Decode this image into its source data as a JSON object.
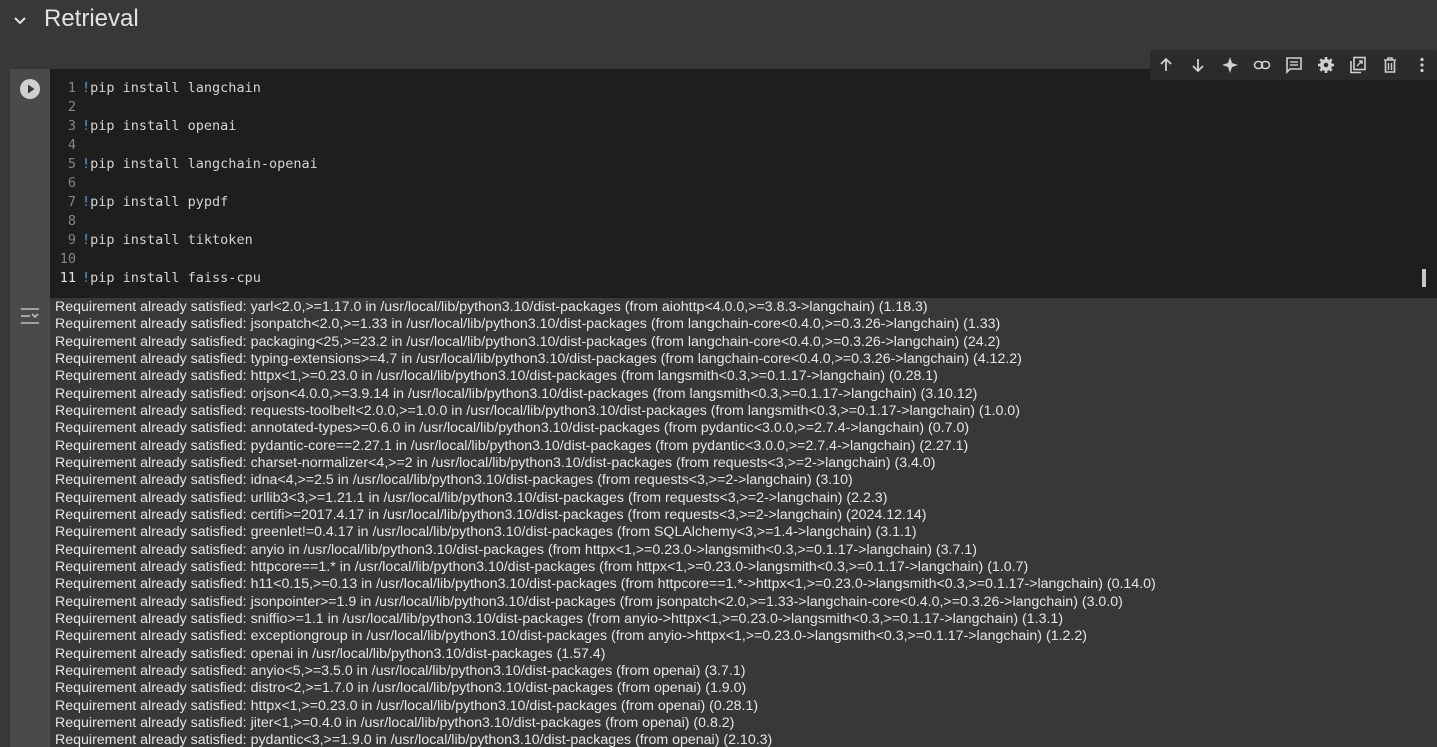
{
  "section": {
    "title": "Retrieval"
  },
  "code_lines": [
    {
      "num": "1",
      "bang": "!",
      "text": "pip install langchain"
    },
    {
      "num": "2",
      "bang": "",
      "text": ""
    },
    {
      "num": "3",
      "bang": "!",
      "text": "pip install openai"
    },
    {
      "num": "4",
      "bang": "",
      "text": ""
    },
    {
      "num": "5",
      "bang": "!",
      "text": "pip install langchain-openai"
    },
    {
      "num": "6",
      "bang": "",
      "text": ""
    },
    {
      "num": "7",
      "bang": "!",
      "text": "pip install pypdf"
    },
    {
      "num": "8",
      "bang": "",
      "text": ""
    },
    {
      "num": "9",
      "bang": "!",
      "text": "pip install tiktoken"
    },
    {
      "num": "10",
      "bang": "",
      "text": ""
    },
    {
      "num": "11",
      "bang": "!",
      "text": "pip install faiss-cpu"
    }
  ],
  "toolbar_icons": [
    "move-up-icon",
    "move-down-icon",
    "sparkle-icon",
    "link-icon",
    "comment-icon",
    "settings-icon",
    "mirror-cell-icon",
    "delete-icon",
    "more-options-icon"
  ],
  "output_lines": [
    "Requirement already satisfied: yarl<2.0,>=1.17.0 in /usr/local/lib/python3.10/dist-packages (from aiohttp<4.0.0,>=3.8.3->langchain) (1.18.3)",
    "Requirement already satisfied: jsonpatch<2.0,>=1.33 in /usr/local/lib/python3.10/dist-packages (from langchain-core<0.4.0,>=0.3.26->langchain) (1.33)",
    "Requirement already satisfied: packaging<25,>=23.2 in /usr/local/lib/python3.10/dist-packages (from langchain-core<0.4.0,>=0.3.26->langchain) (24.2)",
    "Requirement already satisfied: typing-extensions>=4.7 in /usr/local/lib/python3.10/dist-packages (from langchain-core<0.4.0,>=0.3.26->langchain) (4.12.2)",
    "Requirement already satisfied: httpx<1,>=0.23.0 in /usr/local/lib/python3.10/dist-packages (from langsmith<0.3,>=0.1.17->langchain) (0.28.1)",
    "Requirement already satisfied: orjson<4.0.0,>=3.9.14 in /usr/local/lib/python3.10/dist-packages (from langsmith<0.3,>=0.1.17->langchain) (3.10.12)",
    "Requirement already satisfied: requests-toolbelt<2.0.0,>=1.0.0 in /usr/local/lib/python3.10/dist-packages (from langsmith<0.3,>=0.1.17->langchain) (1.0.0)",
    "Requirement already satisfied: annotated-types>=0.6.0 in /usr/local/lib/python3.10/dist-packages (from pydantic<3.0.0,>=2.7.4->langchain) (0.7.0)",
    "Requirement already satisfied: pydantic-core==2.27.1 in /usr/local/lib/python3.10/dist-packages (from pydantic<3.0.0,>=2.7.4->langchain) (2.27.1)",
    "Requirement already satisfied: charset-normalizer<4,>=2 in /usr/local/lib/python3.10/dist-packages (from requests<3,>=2->langchain) (3.4.0)",
    "Requirement already satisfied: idna<4,>=2.5 in /usr/local/lib/python3.10/dist-packages (from requests<3,>=2->langchain) (3.10)",
    "Requirement already satisfied: urllib3<3,>=1.21.1 in /usr/local/lib/python3.10/dist-packages (from requests<3,>=2->langchain) (2.2.3)",
    "Requirement already satisfied: certifi>=2017.4.17 in /usr/local/lib/python3.10/dist-packages (from requests<3,>=2->langchain) (2024.12.14)",
    "Requirement already satisfied: greenlet!=0.4.17 in /usr/local/lib/python3.10/dist-packages (from SQLAlchemy<3,>=1.4->langchain) (3.1.1)",
    "Requirement already satisfied: anyio in /usr/local/lib/python3.10/dist-packages (from httpx<1,>=0.23.0->langsmith<0.3,>=0.1.17->langchain) (3.7.1)",
    "Requirement already satisfied: httpcore==1.* in /usr/local/lib/python3.10/dist-packages (from httpx<1,>=0.23.0->langsmith<0.3,>=0.1.17->langchain) (1.0.7)",
    "Requirement already satisfied: h11<0.15,>=0.13 in /usr/local/lib/python3.10/dist-packages (from httpcore==1.*->httpx<1,>=0.23.0->langsmith<0.3,>=0.1.17->langchain) (0.14.0)",
    "Requirement already satisfied: jsonpointer>=1.9 in /usr/local/lib/python3.10/dist-packages (from jsonpatch<2.0,>=1.33->langchain-core<0.4.0,>=0.3.26->langchain) (3.0.0)",
    "Requirement already satisfied: sniffio>=1.1 in /usr/local/lib/python3.10/dist-packages (from anyio->httpx<1,>=0.23.0->langsmith<0.3,>=0.1.17->langchain) (1.3.1)",
    "Requirement already satisfied: exceptiongroup in /usr/local/lib/python3.10/dist-packages (from anyio->httpx<1,>=0.23.0->langsmith<0.3,>=0.1.17->langchain) (1.2.2)",
    "Requirement already satisfied: openai in /usr/local/lib/python3.10/dist-packages (1.57.4)",
    "Requirement already satisfied: anyio<5,>=3.5.0 in /usr/local/lib/python3.10/dist-packages (from openai) (3.7.1)",
    "Requirement already satisfied: distro<2,>=1.7.0 in /usr/local/lib/python3.10/dist-packages (from openai) (1.9.0)",
    "Requirement already satisfied: httpx<1,>=0.23.0 in /usr/local/lib/python3.10/dist-packages (from openai) (0.28.1)",
    "Requirement already satisfied: jiter<1,>=0.4.0 in /usr/local/lib/python3.10/dist-packages (from openai) (0.8.2)",
    "Requirement already satisfied: pydantic<3,>=1.9.0 in /usr/local/lib/python3.10/dist-packages (from openai) (2.10.3)"
  ]
}
